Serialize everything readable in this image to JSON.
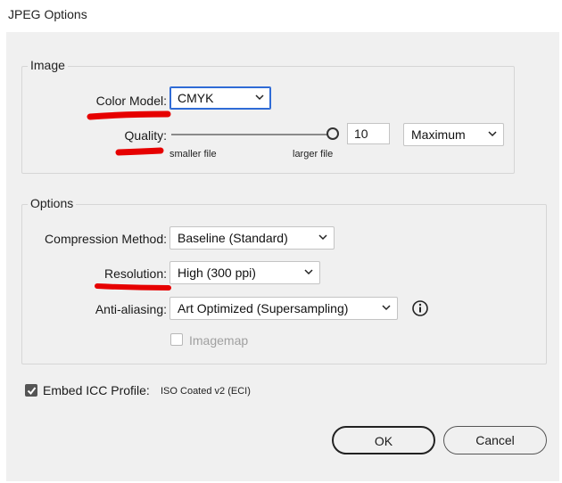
{
  "window": {
    "title": "JPEG Options"
  },
  "image_group": {
    "legend": "Image",
    "color_model": {
      "label": "Color Model:",
      "value": "CMYK"
    },
    "quality": {
      "label": "Quality:",
      "value": "10",
      "slider_fraction": 1.0,
      "min_caption": "smaller file",
      "max_caption": "larger file",
      "preset": "Maximum"
    }
  },
  "options_group": {
    "legend": "Options",
    "compression": {
      "label": "Compression Method:",
      "value": "Baseline (Standard)"
    },
    "resolution": {
      "label": "Resolution:",
      "value": "High (300 ppi)"
    },
    "antialiasing": {
      "label": "Anti-aliasing:",
      "value": "Art Optimized (Supersampling)",
      "info_icon": "info-icon"
    },
    "imagemap": {
      "label": "Imagemap",
      "checked": false,
      "enabled": false
    }
  },
  "icc": {
    "label": "Embed ICC Profile:",
    "value": "ISO Coated v2 (ECI)",
    "checked": true
  },
  "buttons": {
    "ok": "OK",
    "cancel": "Cancel"
  },
  "annotation_color": "#e60000",
  "accent_color": "#2f6bd6"
}
